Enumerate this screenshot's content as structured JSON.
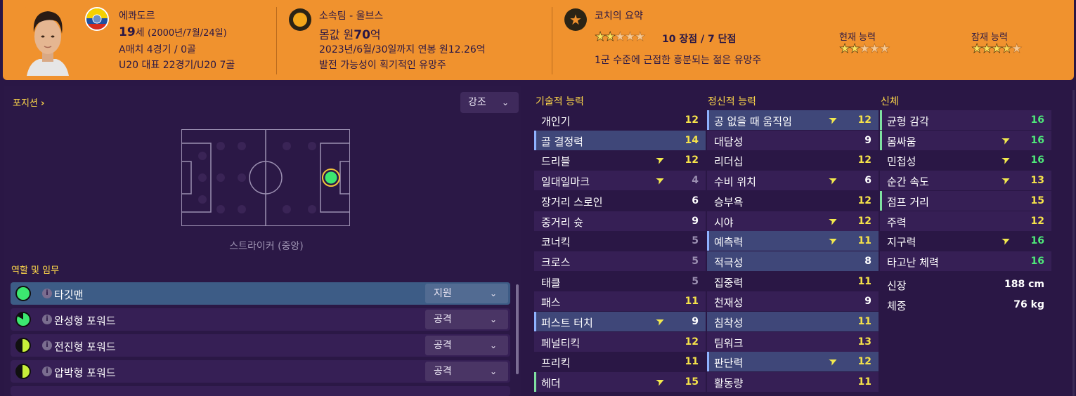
{
  "header": {
    "nationality": "에콰도르",
    "age_value": "19",
    "age_suffix": "세",
    "birth": "(2000년/7월/24일)",
    "caps": "A매치 4경기 / 0골",
    "youth_caps": "U20 대표 22경기/U20 7골",
    "club": "소속팀 - 울브스",
    "value_label": "몸값 원",
    "value_number": "70",
    "value_unit": "억",
    "contract": "2023년/6월/30일까지 연봉 원12.26억",
    "potential_note": "발전 가능성이 획기적인 유망주",
    "coach_title": "코치의 요약",
    "coach_strengths": "10 장점 / 7 단점",
    "coach_summary": "1군 수준에 근접한 흥분되는 젊은 유망주",
    "current_ability_label": "현재 능력",
    "potential_ability_label": "잠재 능력",
    "coach_stars": 2,
    "current_stars": 2,
    "potential_stars": 3.5,
    "accent": "#f0922e"
  },
  "position": {
    "label": "포지션",
    "highlight_label": "강조",
    "position_name": "스트라이커 (중앙)"
  },
  "roles": {
    "label": "역할 및 임무",
    "items": [
      {
        "name": "타깃맨",
        "duty": "지원",
        "active": true,
        "fill": "full"
      },
      {
        "name": "완성형 포워드",
        "duty": "공격",
        "active": false,
        "fill": "mostly"
      },
      {
        "name": "전진형 포워드",
        "duty": "공격",
        "active": false,
        "fill": "half"
      },
      {
        "name": "압박형 포워드",
        "duty": "공격",
        "active": false,
        "fill": "half"
      }
    ]
  },
  "attributes": {
    "technical_label": "기술적 능력",
    "mental_label": "정신적 능력",
    "physical_label": "신체",
    "technical": [
      {
        "name": "개인기",
        "value": "12",
        "arrow": false
      },
      {
        "name": "골 결정력",
        "value": "14",
        "arrow": false
      },
      {
        "name": "드리블",
        "value": "12",
        "arrow": true
      },
      {
        "name": "일대일마크",
        "value": "4",
        "arrow": true
      },
      {
        "name": "장거리 스로인",
        "value": "6",
        "arrow": false
      },
      {
        "name": "중거리 슛",
        "value": "9",
        "arrow": false
      },
      {
        "name": "코너킥",
        "value": "5",
        "arrow": false
      },
      {
        "name": "크로스",
        "value": "5",
        "arrow": false
      },
      {
        "name": "태클",
        "value": "5",
        "arrow": false
      },
      {
        "name": "패스",
        "value": "11",
        "arrow": false
      },
      {
        "name": "퍼스트 터치",
        "value": "9",
        "arrow": true
      },
      {
        "name": "페널티킥",
        "value": "12",
        "arrow": false
      },
      {
        "name": "프리킥",
        "value": "11",
        "arrow": false
      },
      {
        "name": "헤더",
        "value": "15",
        "arrow": true
      }
    ],
    "mental": [
      {
        "name": "공 없을 때 움직임",
        "value": "12",
        "arrow": true
      },
      {
        "name": "대담성",
        "value": "9",
        "arrow": false
      },
      {
        "name": "리더십",
        "value": "12",
        "arrow": false
      },
      {
        "name": "수비 위치",
        "value": "6",
        "arrow": true
      },
      {
        "name": "승부욕",
        "value": "12",
        "arrow": false
      },
      {
        "name": "시야",
        "value": "12",
        "arrow": true
      },
      {
        "name": "예측력",
        "value": "11",
        "arrow": true
      },
      {
        "name": "적극성",
        "value": "8",
        "arrow": false
      },
      {
        "name": "집중력",
        "value": "11",
        "arrow": false
      },
      {
        "name": "천재성",
        "value": "9",
        "arrow": false
      },
      {
        "name": "침착성",
        "value": "11",
        "arrow": false
      },
      {
        "name": "팀워크",
        "value": "13",
        "arrow": false
      },
      {
        "name": "판단력",
        "value": "12",
        "arrow": true
      },
      {
        "name": "활동량",
        "value": "11",
        "arrow": false
      }
    ],
    "physical": [
      {
        "name": "균형 감각",
        "value": "16",
        "arrow": false
      },
      {
        "name": "몸싸움",
        "value": "16",
        "arrow": true
      },
      {
        "name": "민첩성",
        "value": "16",
        "arrow": true
      },
      {
        "name": "순간 속도",
        "value": "13",
        "arrow": true
      },
      {
        "name": "점프 거리",
        "value": "15",
        "arrow": false
      },
      {
        "name": "주력",
        "value": "12",
        "arrow": false
      },
      {
        "name": "지구력",
        "value": "16",
        "arrow": true
      },
      {
        "name": "타고난 체력",
        "value": "16",
        "arrow": false
      }
    ],
    "height_label": "신장",
    "height_value": "188 cm",
    "weight_label": "체중",
    "weight_value": "76 kg"
  }
}
